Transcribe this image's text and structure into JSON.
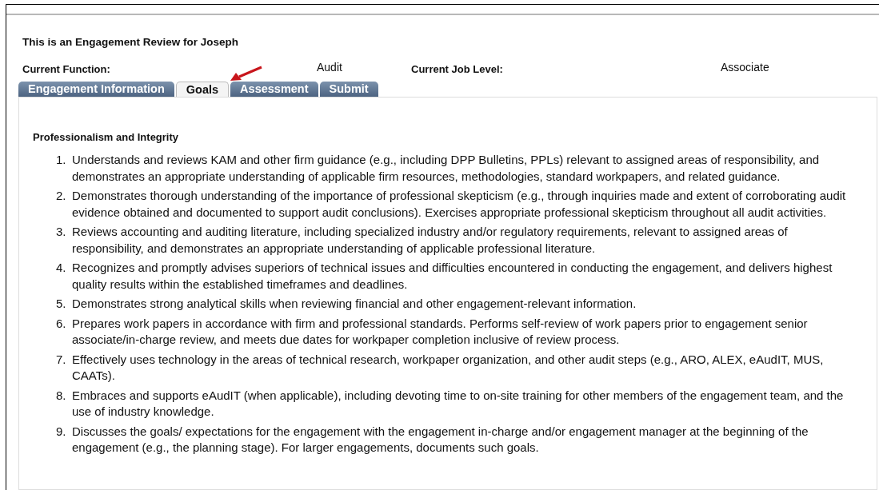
{
  "title": "This is an Engagement Review for Joseph",
  "fields": [
    {
      "label": "Current Function:",
      "value": "Audit"
    },
    {
      "label": "Current Job Level:",
      "value": "Associate"
    }
  ],
  "tabs": [
    {
      "label": "Engagement Information",
      "selected": false
    },
    {
      "label": "Goals",
      "selected": true
    },
    {
      "label": "Assessment",
      "selected": false
    },
    {
      "label": "Submit",
      "selected": false
    }
  ],
  "section": {
    "heading": "Professionalism and Integrity",
    "items": [
      {
        "number": "1.",
        "text": "Understands and reviews KAM and other firm guidance (e.g., including DPP Bulletins, PPLs) relevant to assigned areas of responsibility, and demonstrates an appropriate understanding of applicable firm resources, methodologies, standard workpapers, and related guidance."
      },
      {
        "number": "2.",
        "text": "Demonstrates thorough understanding of the importance of professional skepticism (e.g., through inquiries made and extent of corroborating audit evidence obtained and documented to support audit conclusions). Exercises appropriate professional skepticism throughout all audit activities."
      },
      {
        "number": "3.",
        "text": "Reviews accounting and auditing literature, including specialized industry and/or regulatory requirements, relevant to assigned areas of responsibility, and demonstrates an appropriate understanding of applicable professional literature."
      },
      {
        "number": "4.",
        "text": "Recognizes and promptly advises superiors of technical issues and difficulties encountered in conducting the engagement, and delivers highest quality results within the established timeframes and deadlines."
      },
      {
        "number": "5.",
        "text": "Demonstrates strong analytical skills when reviewing financial and other engagement-relevant information."
      },
      {
        "number": "6.",
        "text": "Prepares work papers in accordance with firm and professional standards. Performs self-review of work papers prior to engagement senior associate/in-charge review, and meets due dates for workpaper completion inclusive of review process."
      },
      {
        "number": "7.",
        "text": "Effectively uses technology in the areas of technical research, workpaper organization, and other audit steps (e.g., ARO, ALEX, eAudIT, MUS, CAATs)."
      },
      {
        "number": "8.",
        "text": "Embraces and supports eAudIT (when applicable), including devoting time to on-site training for other members of the engagement team, and the use of industry knowledge."
      },
      {
        "number": "9.",
        "text": "Discusses the goals/ expectations for the engagement with the engagement in-charge and/or engagement manager at the beginning of the engagement (e.g., the planning stage). For larger engagements, documents such goals."
      }
    ]
  }
}
